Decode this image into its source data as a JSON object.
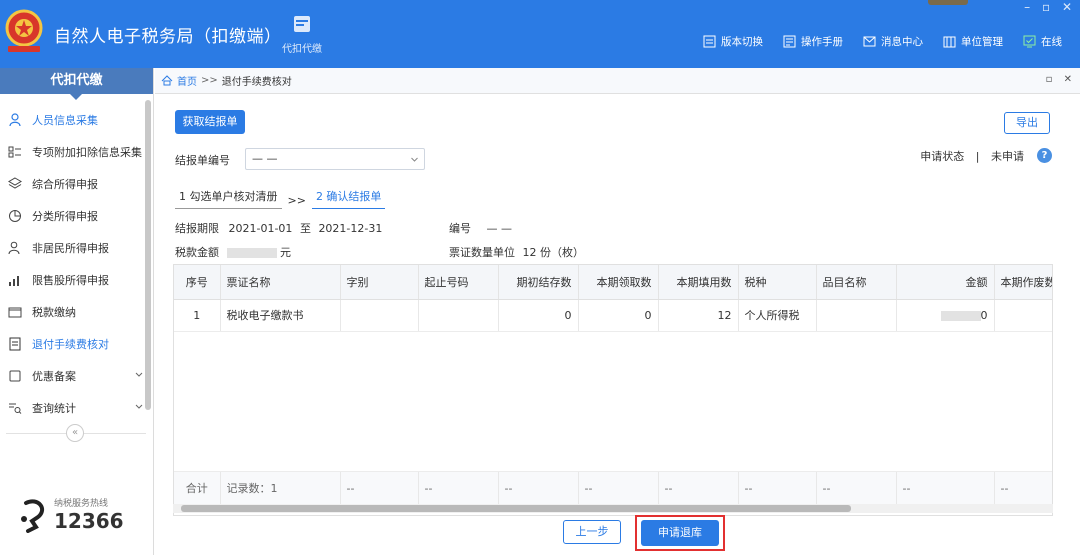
{
  "header": {
    "app_title": "自然人电子税务局（扣缴端）",
    "module_label": "代扣代缴",
    "window_controls": [
      "–",
      "▫",
      "✕"
    ],
    "menu": [
      {
        "label": "版本切换",
        "icon": "version-switch-icon"
      },
      {
        "label": "操作手册",
        "icon": "manual-icon"
      },
      {
        "label": "消息中心",
        "icon": "message-icon"
      },
      {
        "label": "单位管理",
        "icon": "unit-icon"
      }
    ],
    "online_label": "在线",
    "colors": {
      "primary": "#2b7be4",
      "online": "#8ff0a0"
    }
  },
  "sidebar": {
    "title": "代扣代缴",
    "items": [
      {
        "label": "人员信息采集",
        "icon": "person-icon"
      },
      {
        "label": "专项附加扣除信息采集",
        "icon": "list-icon"
      },
      {
        "label": "综合所得申报",
        "icon": "layers-icon"
      },
      {
        "label": "分类所得申报",
        "icon": "pie-icon"
      },
      {
        "label": "非居民所得申报",
        "icon": "user-outline-icon"
      },
      {
        "label": "限售股所得申报",
        "icon": "bars-icon"
      },
      {
        "label": "税款缴纳",
        "icon": "wallet-icon"
      },
      {
        "label": "退付手续费核对",
        "icon": "doc-icon"
      },
      {
        "label": "优惠备案",
        "icon": "square-icon"
      },
      {
        "label": "查询统计",
        "icon": "search-list-icon"
      }
    ],
    "collapse_label": "«",
    "hotline_label": "纳税服务热线",
    "hotline_number": "12366"
  },
  "breadcrumb": {
    "home": "首页",
    "sep": ">>",
    "current": "退付手续费核对",
    "tools": [
      "▫",
      "✕"
    ]
  },
  "toolbar": {
    "fetch_report": "获取结报单",
    "export": "导出"
  },
  "form": {
    "report_no_label": "结报单编号",
    "report_no_value": "— —",
    "apply_status_label": "申请状态",
    "apply_status_sep": "|",
    "apply_status_value": "未申请",
    "help": "?"
  },
  "steps": {
    "step1": "1 勾选单户核对清册",
    "arrow": ">>",
    "step2": "2 确认结报单"
  },
  "info": {
    "period_label": "结报期限",
    "period_start": "2021-01-01",
    "period_to": "至",
    "period_end": "2021-12-31",
    "code_label": "编号",
    "code_value": "— —",
    "tax_amount_label": "税款金额",
    "tax_amount_unit": "元",
    "ticket_count_label": "票证数量单位",
    "ticket_count_value": "12 份（枚）"
  },
  "table": {
    "headers": [
      "序号",
      "票证名称",
      "字别",
      "起止号码",
      "期初结存数",
      "本期领取数",
      "本期填用数",
      "税种",
      "品目名称",
      "金额",
      "本期作废数"
    ],
    "rows": [
      [
        "1",
        "税收电子缴款书",
        "",
        "",
        "0",
        "0",
        "12",
        "个人所得税",
        "",
        "",
        ""
      ]
    ],
    "amount_suffix": "0",
    "sum_row": [
      "合计",
      "记录数：1",
      "--",
      "--",
      "--",
      "--",
      "--",
      "--",
      "--",
      "--",
      "--"
    ]
  },
  "footer": {
    "prev": "上一步",
    "apply_return": "申请退库"
  }
}
